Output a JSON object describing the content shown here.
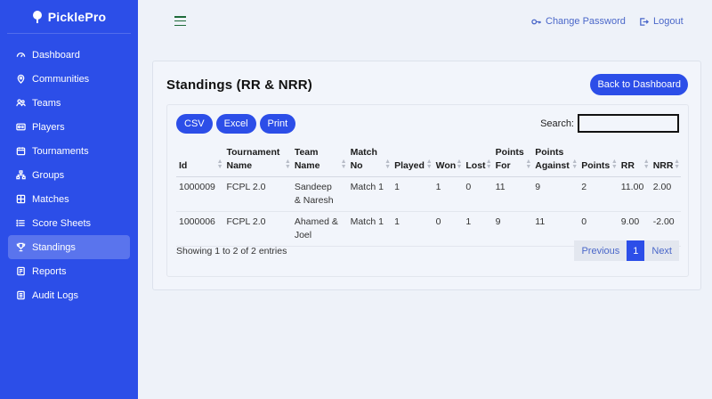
{
  "brand": {
    "name": "PicklePro"
  },
  "sidebar": {
    "items": [
      {
        "label": "Dashboard",
        "icon": "gauge-icon"
      },
      {
        "label": "Communities",
        "icon": "location-pin-icon"
      },
      {
        "label": "Teams",
        "icon": "users-icon"
      },
      {
        "label": "Players",
        "icon": "id-card-icon"
      },
      {
        "label": "Tournaments",
        "icon": "calendar-icon"
      },
      {
        "label": "Groups",
        "icon": "sitemap-icon"
      },
      {
        "label": "Matches",
        "icon": "grid-icon"
      },
      {
        "label": "Score Sheets",
        "icon": "list-icon"
      },
      {
        "label": "Standings",
        "icon": "trophy-icon",
        "active": true
      },
      {
        "label": "Reports",
        "icon": "report-icon"
      },
      {
        "label": "Audit Logs",
        "icon": "log-icon"
      }
    ]
  },
  "topbar": {
    "change_password": "Change Password",
    "logout": "Logout"
  },
  "page": {
    "title": "Standings (RR & NRR)",
    "back_button": "Back to Dashboard"
  },
  "toolbar": {
    "csv": "CSV",
    "excel": "Excel",
    "print": "Print",
    "search_label": "Search:",
    "search_value": ""
  },
  "table": {
    "headers": [
      [
        "Id"
      ],
      [
        "Tournament",
        "Name"
      ],
      [
        "Team",
        "Name"
      ],
      [
        "Match",
        "No"
      ],
      [
        "Played"
      ],
      [
        "Won"
      ],
      [
        "Lost"
      ],
      [
        "Points",
        "For"
      ],
      [
        "Points",
        "Against"
      ],
      [
        "Points"
      ],
      [
        "RR"
      ],
      [
        "NRR"
      ]
    ],
    "rows": [
      {
        "cells": [
          [
            "1000009"
          ],
          [
            "FCPL 2.0"
          ],
          [
            "Sandeep",
            "& Naresh"
          ],
          [
            "Match 1"
          ],
          [
            "1"
          ],
          [
            "1"
          ],
          [
            "0"
          ],
          [
            "11"
          ],
          [
            "9"
          ],
          [
            "2"
          ],
          [
            "11.00"
          ],
          [
            "2.00"
          ]
        ]
      },
      {
        "cells": [
          [
            "1000006"
          ],
          [
            "FCPL 2.0"
          ],
          [
            "Ahamed &",
            "Joel"
          ],
          [
            "Match 1"
          ],
          [
            "1"
          ],
          [
            "0"
          ],
          [
            "1"
          ],
          [
            "9"
          ],
          [
            "11"
          ],
          [
            "0"
          ],
          [
            "9.00"
          ],
          [
            "-2.00"
          ]
        ]
      }
    ]
  },
  "footer": {
    "info": "Showing 1 to 2 of 2 entries",
    "previous": "Previous",
    "current_page": "1",
    "next": "Next"
  },
  "colors": {
    "primary": "#2c4ee8",
    "background": "#eef2f9",
    "link": "#4a67c9"
  }
}
